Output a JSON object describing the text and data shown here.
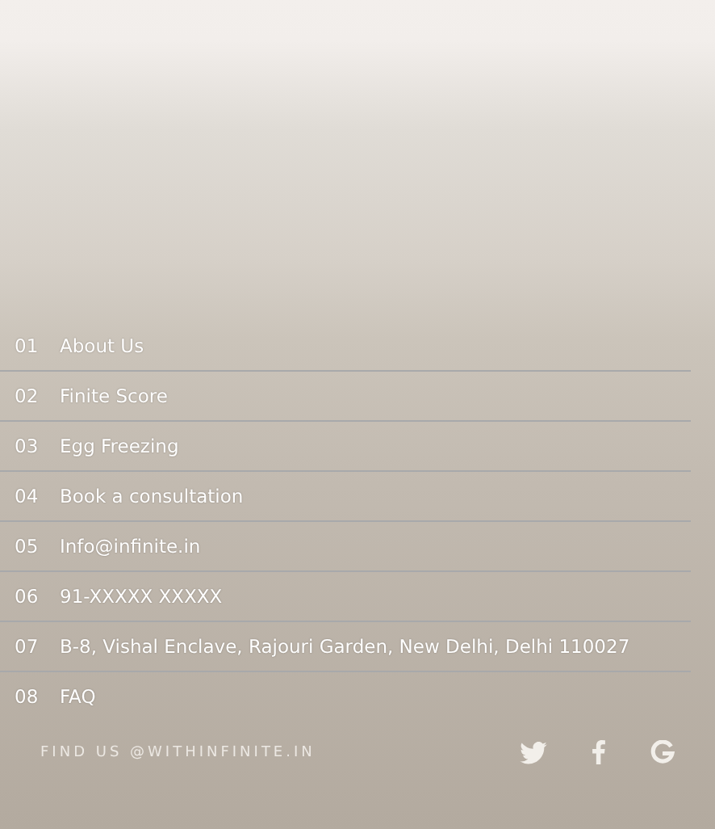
{
  "menu": [
    {
      "number": "01",
      "label": "About Us"
    },
    {
      "number": "02",
      "label": "Finite Score"
    },
    {
      "number": "03",
      "label": "Egg Freezing"
    },
    {
      "number": "04",
      "label": "Book a consultation"
    },
    {
      "number": "05",
      "label": "Info@infinite.in"
    },
    {
      "number": "06",
      "label": "91-XXXXX XXXXX"
    },
    {
      "number": "07",
      "label": "B-8, Vishal Enclave, Rajouri Garden, New Delhi, Delhi 110027"
    },
    {
      "number": "08",
      "label": "FAQ"
    }
  ],
  "footer": {
    "text": "FIND US @WITHINFINITE.IN",
    "social": [
      {
        "kind": "twitter"
      },
      {
        "kind": "facebook"
      },
      {
        "kind": "google"
      }
    ]
  }
}
